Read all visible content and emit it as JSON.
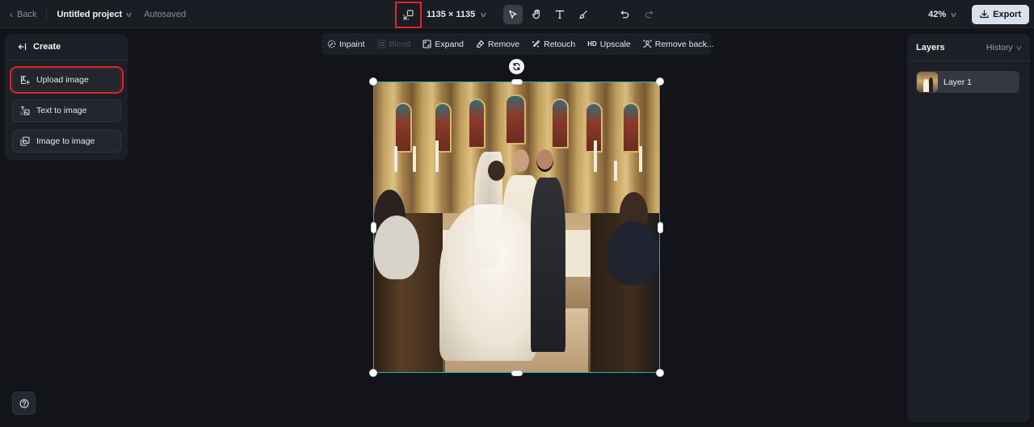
{
  "topbar": {
    "back_label": "Back",
    "project_title": "Untitled project",
    "autosave_status": "Autosaved",
    "canvas_size": "1135 × 1135",
    "zoom_level": "42%",
    "export_label": "Export",
    "tools": [
      {
        "icon": "pointer-icon",
        "active": true
      },
      {
        "icon": "hand-icon",
        "active": false
      },
      {
        "icon": "text-icon",
        "active": false
      },
      {
        "icon": "brush-icon",
        "active": false
      }
    ],
    "history": [
      {
        "icon": "undo-icon",
        "enabled": true
      },
      {
        "icon": "redo-icon",
        "enabled": false
      }
    ]
  },
  "left_panel": {
    "header": "Create",
    "items": [
      {
        "label": "Upload image",
        "icon": "upload-image-icon",
        "highlighted": true
      },
      {
        "label": "Text to image",
        "icon": "text-to-image-icon",
        "highlighted": false
      },
      {
        "label": "Image to image",
        "icon": "image-to-image-icon",
        "highlighted": false
      }
    ]
  },
  "image_toolbar": {
    "items": [
      {
        "label": "Inpaint",
        "icon": "inpaint-icon",
        "enabled": true
      },
      {
        "label": "Blend",
        "icon": "blend-icon",
        "enabled": false
      },
      {
        "label": "Expand",
        "icon": "expand-icon",
        "enabled": true
      },
      {
        "label": "Remove",
        "icon": "eraser-icon",
        "enabled": true
      },
      {
        "label": "Retouch",
        "icon": "retouch-icon",
        "enabled": true
      },
      {
        "label": "Upscale",
        "icon_text": "HD",
        "enabled": true
      },
      {
        "label": "Remove back...",
        "icon": "remove-background-icon",
        "enabled": true
      }
    ]
  },
  "canvas": {
    "image_alt": "Wedding ceremony in a church: bride and groom holding hands before a priest at an ornate golden altar, guests seated in wooden pews",
    "selection_color": "#1fb5b0"
  },
  "right_panel": {
    "title": "Layers",
    "history_label": "History",
    "layers": [
      {
        "name": "Layer 1"
      }
    ]
  },
  "colors": {
    "background": "#121419",
    "panel": "#1c1f26",
    "highlight_outline": "#e3242b",
    "export_button": "#d9e2ec"
  }
}
